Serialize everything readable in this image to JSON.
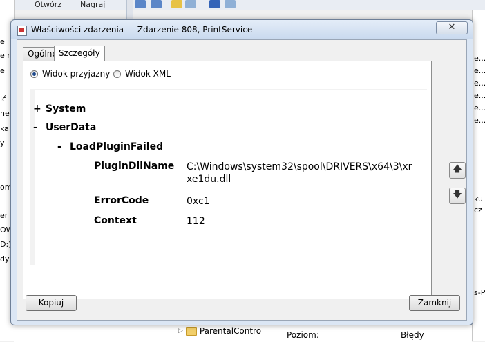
{
  "background": {
    "toolbar": {
      "open_label": "Otwórz",
      "burn_label": "Nagraj"
    },
    "left_fragments": [
      "e",
      "e r",
      "e",
      "ić",
      "ner",
      "ka",
      "y",
      "om",
      "er",
      "OW",
      "D:)",
      "dys"
    ],
    "right_fragments": [
      "e...",
      "e...",
      "e...",
      "e...",
      "e...",
      "e...",
      "ku",
      "cz d",
      "s-Pr"
    ],
    "tree_item": "ParentalContro",
    "level_label": "Poziom:",
    "level_value": "Błędy"
  },
  "dialog": {
    "title": "Właściwości zdarzenia — Zdarzenie 808, PrintService",
    "close_symbol": "✕",
    "tabs": [
      {
        "label": "Ogólne",
        "active": false
      },
      {
        "label": "Szczegóły",
        "active": true
      }
    ],
    "view_options": [
      {
        "label": "Widok przyjazny",
        "selected": true
      },
      {
        "label": "Widok XML",
        "selected": false
      }
    ],
    "details": {
      "system_toggle": "+",
      "system_label": "System",
      "userdata_toggle": "-",
      "userdata_label": "UserData",
      "loadplugin_toggle": "-",
      "loadplugin_label": "LoadPluginFailed",
      "fields": [
        {
          "key": "PluginDllName",
          "value": "C:\\Windows\\system32\\spool\\DRIVERS\\x64\\3\\xrxe1du.dll"
        },
        {
          "key": "ErrorCode",
          "value": "0xc1"
        },
        {
          "key": "Context",
          "value": "112"
        }
      ]
    },
    "up_symbol": "🡅",
    "down_symbol": "🡇",
    "copy_label": "Kopiuj",
    "close_label": "Zamknij"
  }
}
